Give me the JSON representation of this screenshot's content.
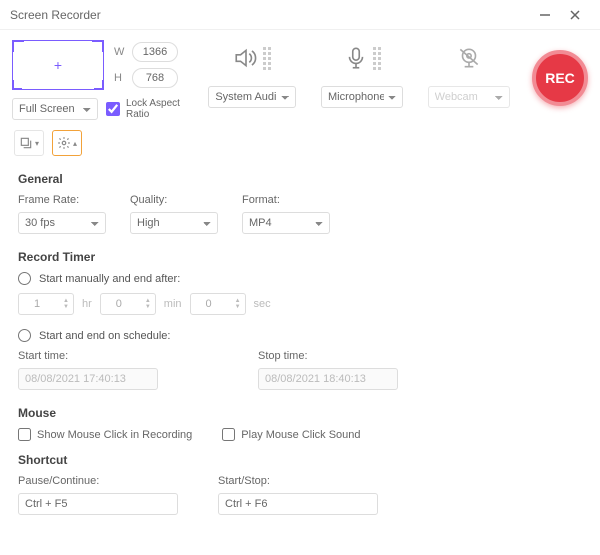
{
  "window": {
    "title": "Screen Recorder"
  },
  "region": {
    "width": "1366",
    "height": "768",
    "width_label": "W",
    "height_label": "H",
    "mode": "Full Screen",
    "lock_label": "Lock Aspect\nRatio",
    "lock_checked": true
  },
  "sources": {
    "audio": {
      "label": "System Audio"
    },
    "mic": {
      "label": "Microphone"
    },
    "webcam": {
      "label": "Webcam"
    }
  },
  "rec": {
    "label": "REC"
  },
  "settings": {
    "general": {
      "title": "General",
      "frame_rate_label": "Frame Rate:",
      "frame_rate": "30 fps",
      "quality_label": "Quality:",
      "quality": "High",
      "format_label": "Format:",
      "format": "MP4"
    },
    "timer": {
      "title": "Record Timer",
      "manual_label": "Start manually and end after:",
      "hr": "1",
      "hr_unit": "hr",
      "min": "0",
      "min_unit": "min",
      "sec": "0",
      "sec_unit": "sec",
      "schedule_label": "Start and end on schedule:",
      "start_label": "Start time:",
      "start_value": "08/08/2021 17:40:13",
      "stop_label": "Stop time:",
      "stop_value": "08/08/2021 18:40:13"
    },
    "mouse": {
      "title": "Mouse",
      "show_click": "Show Mouse Click in Recording",
      "play_sound": "Play Mouse Click Sound"
    },
    "shortcut": {
      "title": "Shortcut",
      "pause_label": "Pause/Continue:",
      "pause_value": "Ctrl + F5",
      "startstop_label": "Start/Stop:",
      "startstop_value": "Ctrl + F6"
    }
  }
}
